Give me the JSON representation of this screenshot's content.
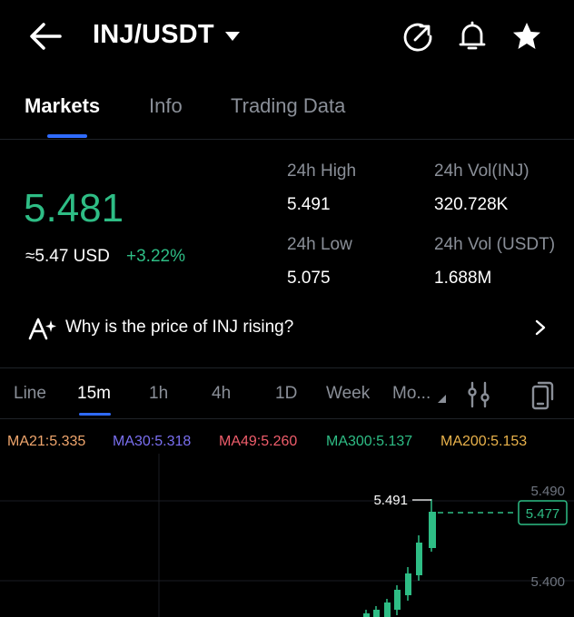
{
  "header": {
    "pair": "INJ/USDT"
  },
  "tabs": [
    {
      "label": "Markets"
    },
    {
      "label": "Info"
    },
    {
      "label": "Trading Data"
    }
  ],
  "ticker": {
    "last_price": "5.481",
    "usd_price": "≈5.47 USD",
    "change": "+3.22%",
    "stats": {
      "high_label": "24h High",
      "high_value": "5.491",
      "low_label": "24h Low",
      "low_value": "5.075",
      "vol_inj_label": "24h Vol(INJ)",
      "vol_inj_value": "320.728K",
      "vol_usdt_label": "24h Vol (USDT)",
      "vol_usdt_value": "1.688M"
    }
  },
  "insight": {
    "text": "Why is the price of INJ rising?"
  },
  "timeframes": [
    {
      "label": "Line"
    },
    {
      "label": "15m"
    },
    {
      "label": "1h"
    },
    {
      "label": "4h"
    },
    {
      "label": "1D"
    },
    {
      "label": "Week"
    },
    {
      "label": "Mo..."
    }
  ],
  "selected_timeframe": "15m",
  "moving_averages": [
    {
      "label": "MA21:5.335",
      "color": "#f0a66d"
    },
    {
      "label": "MA30:5.318",
      "color": "#7a6ff0"
    },
    {
      "label": "MA49:5.260",
      "color": "#ef5d6b"
    },
    {
      "label": "MA300:5.137",
      "color": "#2ebd85"
    },
    {
      "label": "MA200:5.153",
      "color": "#e9b24b"
    }
  ],
  "chart": {
    "y_ticks": [
      "5.490",
      "5.400"
    ],
    "high_marker": "5.491",
    "current_price_tag": "5.477",
    "colors": {
      "up": "#2ebd85",
      "grid": "#1a1d22"
    }
  }
}
